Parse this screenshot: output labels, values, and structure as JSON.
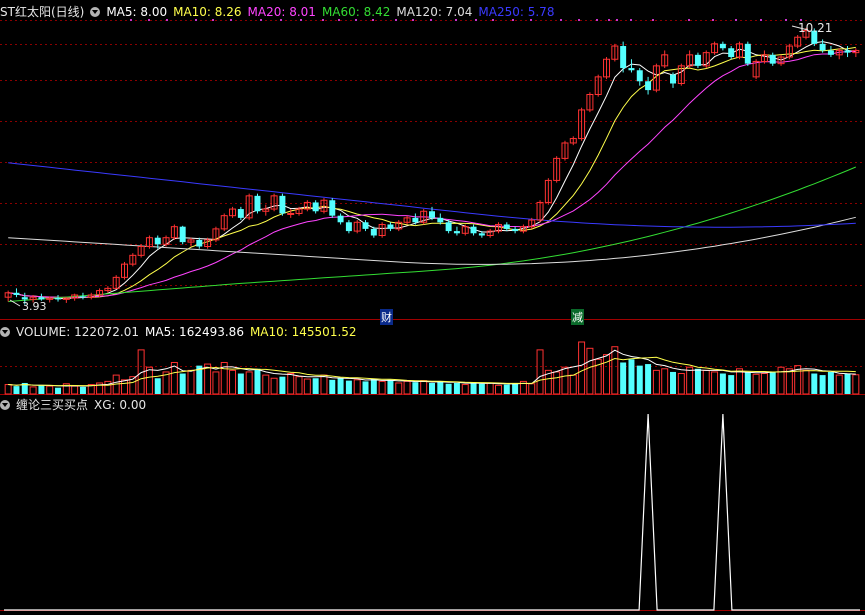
{
  "price_panel": {
    "title": "ST红太阳(日线)",
    "ma": [
      {
        "label": "MA5: 8.00",
        "color": "#ffffff"
      },
      {
        "label": "MA10: 8.26",
        "color": "#ffff4c"
      },
      {
        "label": "MA20: 8.01",
        "color": "#ff44ff"
      },
      {
        "label": "MA60: 8.42",
        "color": "#33dd33"
      },
      {
        "label": "MA120: 7.04",
        "color": "#dddddd"
      },
      {
        "label": "MA250: 5.78",
        "color": "#3a3aff"
      }
    ],
    "high_label": "10.21",
    "low_label": "3.93",
    "markers": [
      "财",
      "减"
    ]
  },
  "volume_panel": {
    "name": "VOLUME: 122072.01",
    "ma5": "MA5: 162493.86",
    "ma10": "MA10: 145501.52"
  },
  "signal_panel": {
    "name": "缠论三买买点",
    "xg": "XG: 0.00"
  },
  "colors": {
    "up": "#ff3232",
    "down": "#54ffff",
    "grid": "#8b0000",
    "signal": "#ffffff"
  },
  "chart_data": {
    "type": "candlestick",
    "title": "ST红太阳(日线)",
    "price_range": [
      3.9,
      10.3
    ],
    "candles": [
      {
        "o": 4.1,
        "h": 4.25,
        "l": 4.0,
        "c": 4.2
      },
      {
        "o": 4.2,
        "h": 4.3,
        "l": 4.1,
        "c": 4.15
      },
      {
        "o": 4.1,
        "h": 4.2,
        "l": 3.93,
        "c": 4.05
      },
      {
        "o": 4.05,
        "h": 4.15,
        "l": 3.98,
        "c": 4.1
      },
      {
        "o": 4.1,
        "h": 4.18,
        "l": 4.02,
        "c": 4.05
      },
      {
        "o": 4.05,
        "h": 4.12,
        "l": 3.98,
        "c": 4.08
      },
      {
        "o": 4.08,
        "h": 4.15,
        "l": 4.0,
        "c": 4.05
      },
      {
        "o": 4.05,
        "h": 4.1,
        "l": 3.97,
        "c": 4.08
      },
      {
        "o": 4.08,
        "h": 4.18,
        "l": 4.02,
        "c": 4.15
      },
      {
        "o": 4.12,
        "h": 4.2,
        "l": 4.05,
        "c": 4.1
      },
      {
        "o": 4.1,
        "h": 4.2,
        "l": 4.05,
        "c": 4.15
      },
      {
        "o": 4.15,
        "h": 4.3,
        "l": 4.1,
        "c": 4.25
      },
      {
        "o": 4.25,
        "h": 4.35,
        "l": 4.2,
        "c": 4.3
      },
      {
        "o": 4.3,
        "h": 4.6,
        "l": 4.28,
        "c": 4.55
      },
      {
        "o": 4.55,
        "h": 4.9,
        "l": 4.5,
        "c": 4.85
      },
      {
        "o": 4.85,
        "h": 5.1,
        "l": 4.8,
        "c": 5.05
      },
      {
        "o": 5.05,
        "h": 5.3,
        "l": 5.0,
        "c": 5.25
      },
      {
        "o": 5.25,
        "h": 5.5,
        "l": 5.2,
        "c": 5.45
      },
      {
        "o": 5.45,
        "h": 5.5,
        "l": 5.2,
        "c": 5.3
      },
      {
        "o": 5.3,
        "h": 5.5,
        "l": 5.25,
        "c": 5.45
      },
      {
        "o": 5.45,
        "h": 5.75,
        "l": 5.4,
        "c": 5.7
      },
      {
        "o": 5.7,
        "h": 5.72,
        "l": 5.3,
        "c": 5.35
      },
      {
        "o": 5.35,
        "h": 5.45,
        "l": 5.25,
        "c": 5.4
      },
      {
        "o": 5.4,
        "h": 5.45,
        "l": 5.2,
        "c": 5.25
      },
      {
        "o": 5.25,
        "h": 5.45,
        "l": 5.2,
        "c": 5.4
      },
      {
        "o": 5.4,
        "h": 5.7,
        "l": 5.35,
        "c": 5.65
      },
      {
        "o": 5.65,
        "h": 6.0,
        "l": 5.6,
        "c": 5.95
      },
      {
        "o": 5.95,
        "h": 6.15,
        "l": 5.9,
        "c": 6.1
      },
      {
        "o": 6.1,
        "h": 6.15,
        "l": 5.85,
        "c": 5.9
      },
      {
        "o": 5.9,
        "h": 6.45,
        "l": 5.85,
        "c": 6.4
      },
      {
        "o": 6.4,
        "h": 6.45,
        "l": 6.0,
        "c": 6.05
      },
      {
        "o": 6.05,
        "h": 6.2,
        "l": 5.95,
        "c": 6.1
      },
      {
        "o": 6.1,
        "h": 6.45,
        "l": 6.05,
        "c": 6.4
      },
      {
        "o": 6.4,
        "h": 6.45,
        "l": 5.95,
        "c": 6.0
      },
      {
        "o": 6.0,
        "h": 6.1,
        "l": 5.9,
        "c": 6.0
      },
      {
        "o": 6.0,
        "h": 6.15,
        "l": 5.95,
        "c": 6.1
      },
      {
        "o": 6.1,
        "h": 6.3,
        "l": 6.05,
        "c": 6.25
      },
      {
        "o": 6.25,
        "h": 6.3,
        "l": 6.0,
        "c": 6.05
      },
      {
        "o": 6.05,
        "h": 6.35,
        "l": 6.0,
        "c": 6.3
      },
      {
        "o": 6.3,
        "h": 6.35,
        "l": 5.9,
        "c": 5.95
      },
      {
        "o": 5.95,
        "h": 6.0,
        "l": 5.75,
        "c": 5.8
      },
      {
        "o": 5.8,
        "h": 5.85,
        "l": 5.55,
        "c": 5.6
      },
      {
        "o": 5.6,
        "h": 5.85,
        "l": 5.55,
        "c": 5.8
      },
      {
        "o": 5.8,
        "h": 5.85,
        "l": 5.6,
        "c": 5.65
      },
      {
        "o": 5.65,
        "h": 5.7,
        "l": 5.45,
        "c": 5.5
      },
      {
        "o": 5.5,
        "h": 5.8,
        "l": 5.45,
        "c": 5.75
      },
      {
        "o": 5.75,
        "h": 5.8,
        "l": 5.6,
        "c": 5.65
      },
      {
        "o": 5.65,
        "h": 5.85,
        "l": 5.6,
        "c": 5.8
      },
      {
        "o": 5.8,
        "h": 5.95,
        "l": 5.75,
        "c": 5.9
      },
      {
        "o": 5.9,
        "h": 6.0,
        "l": 5.75,
        "c": 5.8
      },
      {
        "o": 5.8,
        "h": 6.1,
        "l": 5.75,
        "c": 6.05
      },
      {
        "o": 6.05,
        "h": 6.15,
        "l": 5.85,
        "c": 5.9
      },
      {
        "o": 5.9,
        "h": 6.0,
        "l": 5.75,
        "c": 5.8
      },
      {
        "o": 5.8,
        "h": 5.85,
        "l": 5.55,
        "c": 5.6
      },
      {
        "o": 5.6,
        "h": 5.7,
        "l": 5.5,
        "c": 5.55
      },
      {
        "o": 5.55,
        "h": 5.75,
        "l": 5.5,
        "c": 5.7
      },
      {
        "o": 5.7,
        "h": 5.75,
        "l": 5.5,
        "c": 5.55
      },
      {
        "o": 5.55,
        "h": 5.6,
        "l": 5.45,
        "c": 5.5
      },
      {
        "o": 5.5,
        "h": 5.65,
        "l": 5.45,
        "c": 5.6
      },
      {
        "o": 5.6,
        "h": 5.8,
        "l": 5.55,
        "c": 5.75
      },
      {
        "o": 5.75,
        "h": 5.8,
        "l": 5.6,
        "c": 5.65
      },
      {
        "o": 5.65,
        "h": 5.7,
        "l": 5.55,
        "c": 5.6
      },
      {
        "o": 5.6,
        "h": 5.75,
        "l": 5.55,
        "c": 5.7
      },
      {
        "o": 5.7,
        "h": 5.9,
        "l": 5.65,
        "c": 5.85
      },
      {
        "o": 5.85,
        "h": 6.3,
        "l": 5.8,
        "c": 6.25
      },
      {
        "o": 6.25,
        "h": 6.8,
        "l": 6.2,
        "c": 6.75
      },
      {
        "o": 6.75,
        "h": 7.3,
        "l": 6.7,
        "c": 7.25
      },
      {
        "o": 7.25,
        "h": 7.65,
        "l": 7.2,
        "c": 7.6
      },
      {
        "o": 7.6,
        "h": 7.75,
        "l": 7.55,
        "c": 7.7
      },
      {
        "o": 7.7,
        "h": 8.4,
        "l": 7.65,
        "c": 8.35
      },
      {
        "o": 8.35,
        "h": 8.75,
        "l": 8.3,
        "c": 8.7
      },
      {
        "o": 8.7,
        "h": 9.15,
        "l": 8.65,
        "c": 9.1
      },
      {
        "o": 9.1,
        "h": 9.55,
        "l": 9.05,
        "c": 9.5
      },
      {
        "o": 9.5,
        "h": 9.85,
        "l": 9.45,
        "c": 9.8
      },
      {
        "o": 9.8,
        "h": 9.9,
        "l": 9.2,
        "c": 9.3
      },
      {
        "o": 9.3,
        "h": 9.5,
        "l": 9.2,
        "c": 9.25
      },
      {
        "o": 9.25,
        "h": 9.3,
        "l": 8.9,
        "c": 9.0
      },
      {
        "o": 9.0,
        "h": 9.1,
        "l": 8.7,
        "c": 8.8
      },
      {
        "o": 8.8,
        "h": 9.4,
        "l": 8.75,
        "c": 9.35
      },
      {
        "o": 9.35,
        "h": 9.7,
        "l": 9.3,
        "c": 9.6
      },
      {
        "o": 9.15,
        "h": 9.2,
        "l": 8.85,
        "c": 8.95
      },
      {
        "o": 8.95,
        "h": 9.4,
        "l": 8.9,
        "c": 9.35
      },
      {
        "o": 9.35,
        "h": 9.7,
        "l": 9.3,
        "c": 9.6
      },
      {
        "o": 9.6,
        "h": 9.65,
        "l": 9.3,
        "c": 9.35
      },
      {
        "o": 9.35,
        "h": 9.7,
        "l": 9.3,
        "c": 9.65
      },
      {
        "o": 9.65,
        "h": 9.9,
        "l": 9.6,
        "c": 9.85
      },
      {
        "o": 9.85,
        "h": 9.9,
        "l": 9.7,
        "c": 9.75
      },
      {
        "o": 9.75,
        "h": 9.8,
        "l": 9.5,
        "c": 9.55
      },
      {
        "o": 9.55,
        "h": 9.9,
        "l": 9.5,
        "c": 9.85
      },
      {
        "o": 9.85,
        "h": 9.9,
        "l": 9.35,
        "c": 9.4
      },
      {
        "o": 9.1,
        "h": 9.5,
        "l": 9.05,
        "c": 9.45
      },
      {
        "o": 9.45,
        "h": 9.7,
        "l": 9.4,
        "c": 9.6
      },
      {
        "o": 9.6,
        "h": 9.65,
        "l": 9.35,
        "c": 9.4
      },
      {
        "o": 9.4,
        "h": 9.6,
        "l": 9.35,
        "c": 9.55
      },
      {
        "o": 9.55,
        "h": 9.85,
        "l": 9.5,
        "c": 9.8
      },
      {
        "o": 9.8,
        "h": 10.05,
        "l": 9.75,
        "c": 10.0
      },
      {
        "o": 10.0,
        "h": 10.21,
        "l": 9.95,
        "c": 10.15
      },
      {
        "o": 10.15,
        "h": 10.2,
        "l": 9.8,
        "c": 9.85
      },
      {
        "o": 9.85,
        "h": 9.95,
        "l": 9.65,
        "c": 9.7
      },
      {
        "o": 9.7,
        "h": 9.8,
        "l": 9.55,
        "c": 9.6
      },
      {
        "o": 9.6,
        "h": 9.75,
        "l": 9.5,
        "c": 9.7
      },
      {
        "o": 9.7,
        "h": 9.8,
        "l": 9.55,
        "c": 9.65
      },
      {
        "o": 9.65,
        "h": 9.75,
        "l": 9.55,
        "c": 9.7
      }
    ],
    "volume_range": [
      0,
      330000
    ],
    "volumes": [
      60000,
      50000,
      70000,
      45000,
      55000,
      50000,
      40000,
      65000,
      50000,
      45000,
      60000,
      70000,
      80000,
      120000,
      90000,
      110000,
      280000,
      170000,
      100000,
      140000,
      200000,
      130000,
      150000,
      180000,
      190000,
      140000,
      200000,
      150000,
      130000,
      140000,
      160000,
      120000,
      100000,
      110000,
      130000,
      110000,
      95000,
      100000,
      120000,
      90000,
      100000,
      85000,
      90000,
      80000,
      95000,
      80000,
      90000,
      70000,
      80000,
      75000,
      85000,
      70000,
      80000,
      65000,
      70000,
      60000,
      75000,
      65000,
      70000,
      55000,
      60000,
      70000,
      80000,
      65000,
      280000,
      150000,
      140000,
      170000,
      120000,
      330000,
      290000,
      220000,
      250000,
      300000,
      200000,
      220000,
      180000,
      190000,
      150000,
      160000,
      140000,
      130000,
      170000,
      160000,
      150000,
      140000,
      130000,
      120000,
      160000,
      140000,
      125000,
      130000,
      140000,
      170000,
      160000,
      180000,
      150000,
      130000,
      120000,
      140000,
      120000,
      130000,
      122072
    ],
    "signal": {
      "name": "XG",
      "peaks_at_index": [
        77,
        86
      ],
      "range": [
        0,
        1
      ]
    }
  }
}
